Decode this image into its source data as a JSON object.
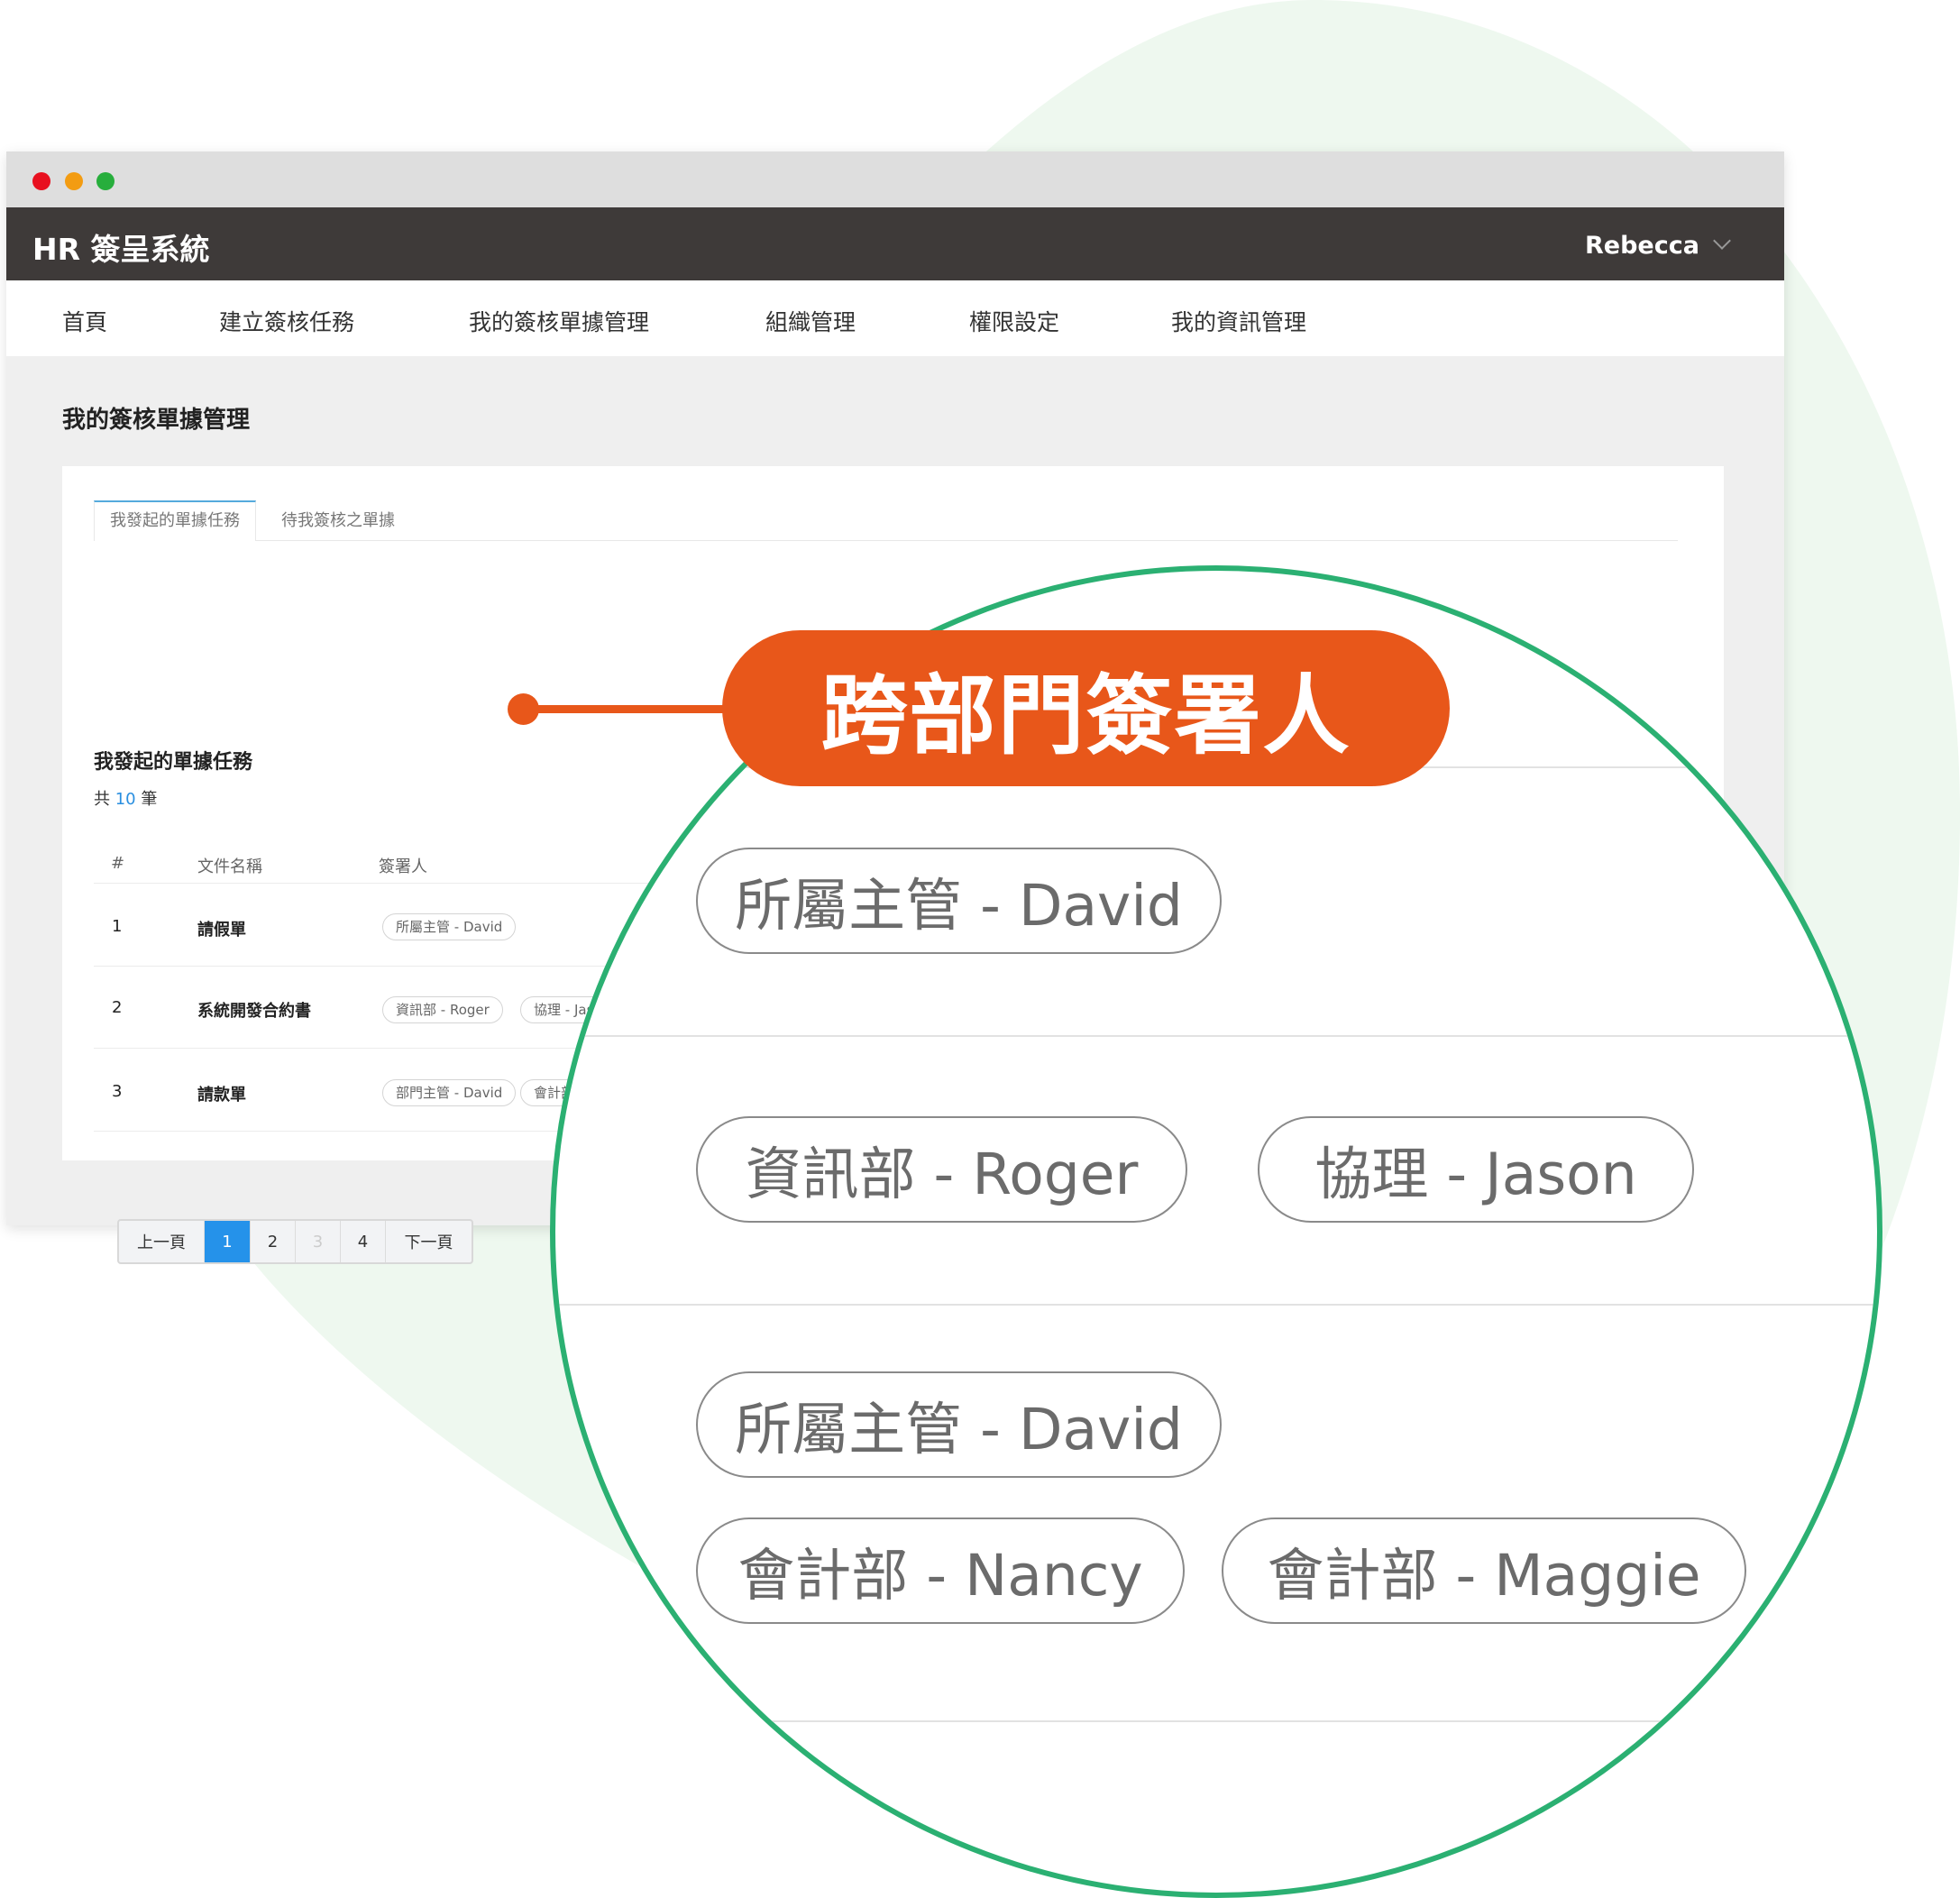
{
  "colors": {
    "accent": "#e8571a",
    "ring": "#2bb072",
    "active_page": "#2592ea",
    "header_bg": "#3e3a39",
    "blob": "#eef8ef"
  },
  "window": {
    "traffic_lights": [
      "#e8101f",
      "#f39c12",
      "#27ae3c"
    ]
  },
  "header": {
    "title": "HR 簽呈系統",
    "user": "Rebecca",
    "user_menu_icon": "chevron-down-icon"
  },
  "nav": {
    "items": [
      "首頁",
      "建立簽核任務",
      "我的簽核單據管理",
      "組織管理",
      "權限設定",
      "我的資訊管理"
    ]
  },
  "page": {
    "title": "我的簽核單據管理"
  },
  "tabs": [
    "我發起的單據任務",
    "待我簽核之單據"
  ],
  "section": {
    "title": "我發起的單據任務",
    "count_prefix": "共",
    "count": "10",
    "count_suffix": "筆"
  },
  "table": {
    "headers": [
      "#",
      "文件名稱",
      "簽署人"
    ],
    "rows": [
      {
        "no": "1",
        "name": "請假單",
        "signers": [
          "所屬主管 - David"
        ]
      },
      {
        "no": "2",
        "name": "系統開發合約書",
        "signers": [
          "資訊部 - Roger",
          "協理 - Jason"
        ]
      },
      {
        "no": "3",
        "name": "請款單",
        "signers": [
          "部門主管 - David",
          "會計部 - Nancy"
        ]
      }
    ]
  },
  "pagination": {
    "prev": "上一頁",
    "pages": [
      "1",
      "2",
      "3",
      "4"
    ],
    "current": "1",
    "disabled": "3",
    "next": "下一頁"
  },
  "callout": {
    "label": "跨部門簽署人"
  },
  "zoomed_signers": {
    "row1": [
      "所屬主管 - David"
    ],
    "row2": [
      "資訊部 - Roger",
      "協理 - Jason"
    ],
    "row3": [
      "所屬主管 - David",
      "會計部 - Nancy",
      "會計部 - Maggie"
    ]
  }
}
